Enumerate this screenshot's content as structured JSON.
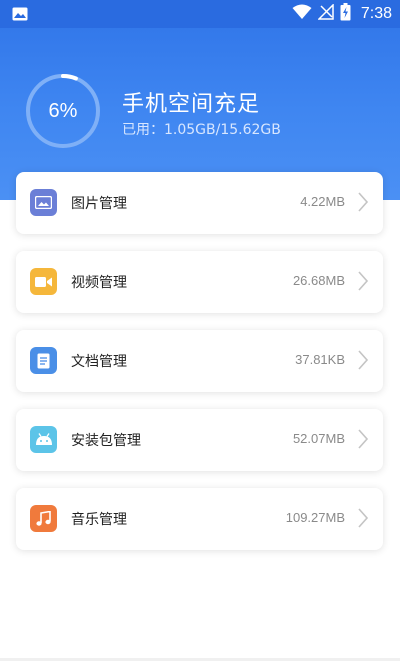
{
  "status_bar": {
    "time": "7:38",
    "icons": [
      "image-icon",
      "wifi-icon",
      "no-signal-icon",
      "battery-charging-icon"
    ]
  },
  "storage": {
    "percent": "6%",
    "used_fraction": 0.06,
    "title": "手机空间充足",
    "usage_text": "已用：1.05GB/15.62GB"
  },
  "categories": [
    {
      "label": "图片管理",
      "size": "4.22MB",
      "icon": "picture-icon",
      "color": "#6b7fd7"
    },
    {
      "label": "视频管理",
      "size": "26.68MB",
      "icon": "video-icon",
      "color": "#f5b73b"
    },
    {
      "label": "文档管理",
      "size": "37.81KB",
      "icon": "document-icon",
      "color": "#4a8fe7"
    },
    {
      "label": "安装包管理",
      "size": "52.07MB",
      "icon": "android-icon",
      "color": "#5cc4e8"
    },
    {
      "label": "音乐管理",
      "size": "109.27MB",
      "icon": "music-icon",
      "color": "#f07a3c"
    }
  ],
  "colors": {
    "header": "#3f86f1",
    "ring_track": "#7fb0f7",
    "ring_progress": "#ffffff"
  }
}
